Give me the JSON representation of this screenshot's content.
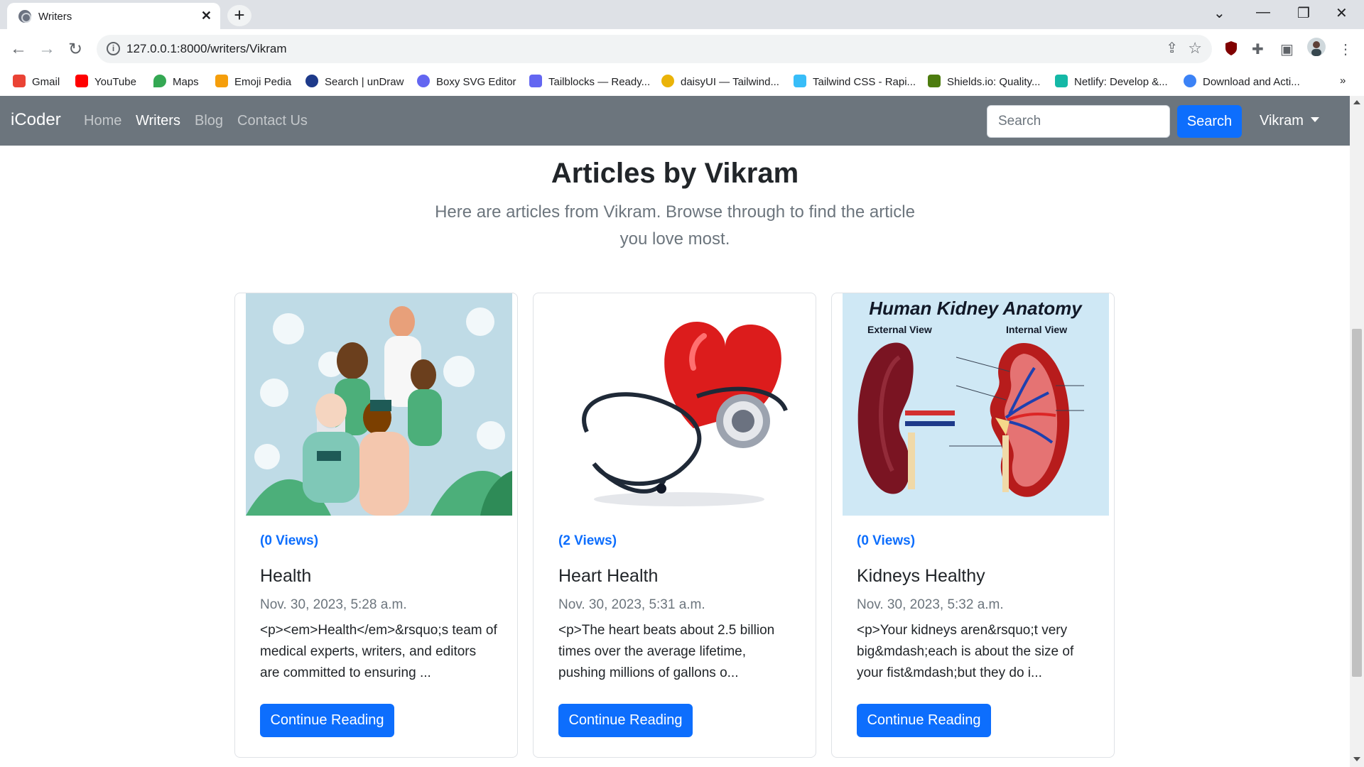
{
  "browser": {
    "tab_title": "Writers",
    "url": "127.0.0.1:8000/writers/Vikram",
    "bookmarks": [
      {
        "label": "Gmail",
        "color": "#ea4335"
      },
      {
        "label": "YouTube",
        "color": "#ff0000"
      },
      {
        "label": "Maps",
        "color": "#34a853"
      },
      {
        "label": "Emoji Pedia",
        "color": "#f59e0b"
      },
      {
        "label": "Search | unDraw",
        "color": "#1e3a8a"
      },
      {
        "label": "Boxy SVG Editor",
        "color": "#6366f1"
      },
      {
        "label": "Tailblocks — Ready...",
        "color": "#6366f1"
      },
      {
        "label": "daisyUI — Tailwind...",
        "color": "#eab308"
      },
      {
        "label": "Tailwind CSS - Rapi...",
        "color": "#38bdf8"
      },
      {
        "label": "Shields.io: Quality...",
        "color": "#4d7c0f"
      },
      {
        "label": "Netlify: Develop &...",
        "color": "#14b8a6"
      },
      {
        "label": "Download and Acti...",
        "color": "#3b82f6"
      }
    ]
  },
  "navbar": {
    "brand": "iCoder",
    "links": [
      "Home",
      "Writers",
      "Blog",
      "Contact Us"
    ],
    "active_link": "Writers",
    "search_placeholder": "Search",
    "search_button": "Search",
    "user": "Vikram"
  },
  "page": {
    "heading": "Articles by Vikram",
    "subtitle": "Here are articles from Vikram. Browse through to find the article you love most."
  },
  "articles": [
    {
      "views": "(0 Views)",
      "title": "Health",
      "date": "Nov. 30, 2023, 5:28 a.m.",
      "excerpt": "<p><em>Health</em>&rsquo;s team of medical experts, writers, and editors are committed to ensuring ...",
      "cta": "Continue Reading",
      "image": "health-illustration"
    },
    {
      "views": "(2 Views)",
      "title": "Heart Health",
      "date": "Nov. 30, 2023, 5:31 a.m.",
      "excerpt": "<p>The heart beats about 2.5 billion times over the average lifetime, pushing millions of gallons o...",
      "cta": "Continue Reading",
      "image": "heart-stethoscope"
    },
    {
      "views": "(0 Views)",
      "title": "Kidneys Healthy",
      "date": "Nov. 30, 2023, 5:32 a.m.",
      "excerpt": "<p>Your kidneys aren&rsquo;t very big&mdash;each is about the size of your fist&mdash;but they do i...",
      "cta": "Continue Reading",
      "image": "kidney-anatomy",
      "image_caption": "Human Kidney Anatomy",
      "image_labels": [
        "External View",
        "Internal View"
      ]
    }
  ],
  "colors": {
    "navbar_bg": "#6c757d",
    "primary": "#0d6efd"
  }
}
